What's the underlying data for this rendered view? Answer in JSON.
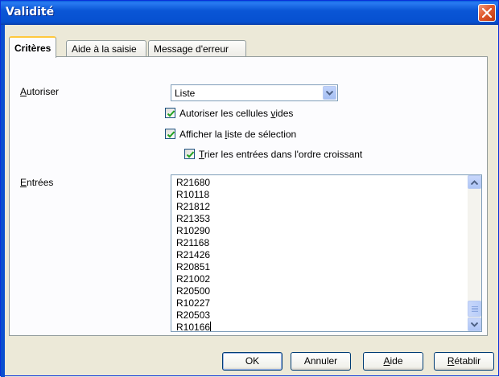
{
  "window": {
    "title": "Validité",
    "close_icon": "close-icon",
    "accent_color": "#0a56d6"
  },
  "tabs": [
    {
      "label": "Critères",
      "active": true
    },
    {
      "label": "Aide à la saisie",
      "active": false
    },
    {
      "label": "Message d'erreur",
      "active": false
    }
  ],
  "criteria": {
    "allow_label_prefix": "",
    "allow_label_mnemonic": "A",
    "allow_label_rest": "utoriser",
    "allow_value": "Liste",
    "checkboxes": [
      {
        "pre": "Autoriser les cellules ",
        "mn": "v",
        "post": "ides",
        "checked": true
      },
      {
        "pre": "Afficher la ",
        "mn": "l",
        "post": "iste de sélection",
        "checked": true
      },
      {
        "pre": "",
        "mn": "T",
        "post": "rier les entrées dans l'ordre croissant",
        "checked": true
      }
    ],
    "entries_label_mnemonic": "E",
    "entries_label_rest": "ntrées",
    "entries": [
      "R21680",
      "R10118",
      "R21812",
      "R21353",
      "R10290",
      "R21168",
      "R21426",
      "R20851",
      "R21002",
      "R20500",
      "R10227",
      "R20503",
      "R10166"
    ]
  },
  "buttons": {
    "ok": "OK",
    "cancel": "Annuler",
    "help_mn": "A",
    "help_rest": "ide",
    "reset_mn": "R",
    "reset_rest": "établir"
  }
}
